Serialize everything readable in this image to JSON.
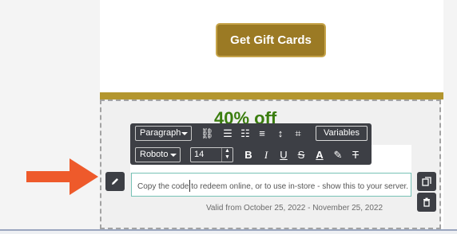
{
  "email": {
    "cta_label": "Get Gift Cards",
    "promo_headline": "40% off",
    "body_text": "Copy the code to redeem online, or to use in-store - show this to your server.",
    "validity_text": "Valid from October 25, 2022 - November 25, 2022"
  },
  "toolbar": {
    "block_format": "Paragraph",
    "font_family": "Roboto",
    "font_size": "14",
    "variables_label": "Variables",
    "stepper_up": "▲",
    "stepper_down": "▼",
    "icons": {
      "unlink": "⛓",
      "bulleted_list": "☰",
      "numbered_list": "☷",
      "align_left": "≡",
      "line_height": "↕",
      "special": "⌗",
      "bold": "B",
      "italic": "I",
      "underline": "U",
      "strikethrough": "S",
      "text_color": "A",
      "highlight": "✎",
      "clear_format": "T"
    }
  },
  "colors": {
    "cta_background": "#9b7a24",
    "gold_band": "#b3962f",
    "headline_green": "#3a7d0e",
    "toolbar_background": "#3d3f45",
    "arrow_orange": "#ee5a2b",
    "focus_border": "#77c2b6"
  }
}
